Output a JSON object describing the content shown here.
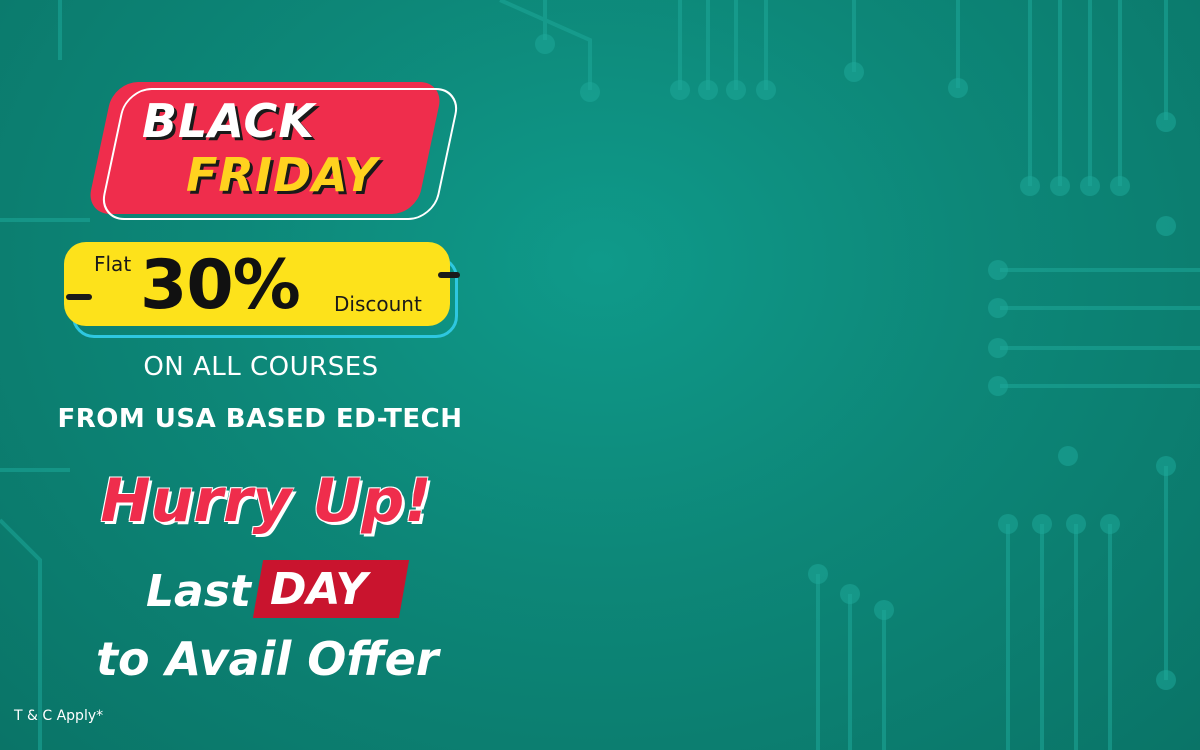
{
  "banner": {
    "black_label": "BLACK",
    "friday_label": "FRIDAY",
    "flat_label": "Flat",
    "percent_label": "30%",
    "discount_label": "Discount",
    "on_all_courses": "ON ALL COURSES",
    "from_usa": "FROM USA BASED ED-TECH",
    "hurry_up": "Hurry Up!",
    "last_label": "Last",
    "day_label": "DAY",
    "avail_label": "to Avail Offer",
    "terms_label": "T & C Apply*"
  },
  "colors": {
    "background": "#0d8778",
    "brand_red": "#ef2d4c",
    "accent_yellow": "#fde21b",
    "accent_cyan": "#2ec7e0",
    "day_red": "#c9142e"
  }
}
